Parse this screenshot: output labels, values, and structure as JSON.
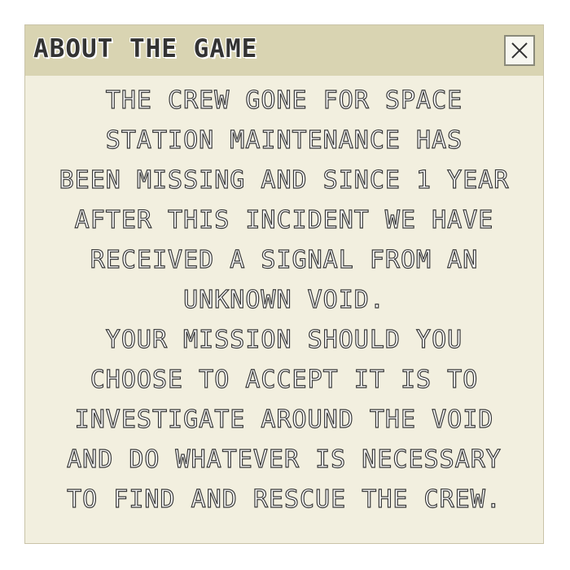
{
  "dialog": {
    "title": "ABOUT THE GAME",
    "close_icon": "close-icon",
    "lines": [
      "THE CREW GONE FOR SPACE",
      "STATION MAINTENANCE HAS",
      "BEEN MISSING AND SINCE 1 YEAR",
      "AFTER THIS INCIDENT WE HAVE",
      "RECEIVED A SIGNAL FROM AN",
      "UNKNOWN VOID.",
      "YOUR MISSION SHOULD YOU",
      "CHOOSE TO ACCEPT IT IS TO",
      "INVESTIGATE AROUND THE VOID",
      "AND DO WHATEVER IS NECESSARY",
      "TO FIND AND RESCUE THE CREW."
    ]
  },
  "colors": {
    "titlebar": "#d9d4b2",
    "body": "#f2efdf",
    "text_fill": "#ffffff",
    "text_outline": "#3a3a3a"
  }
}
